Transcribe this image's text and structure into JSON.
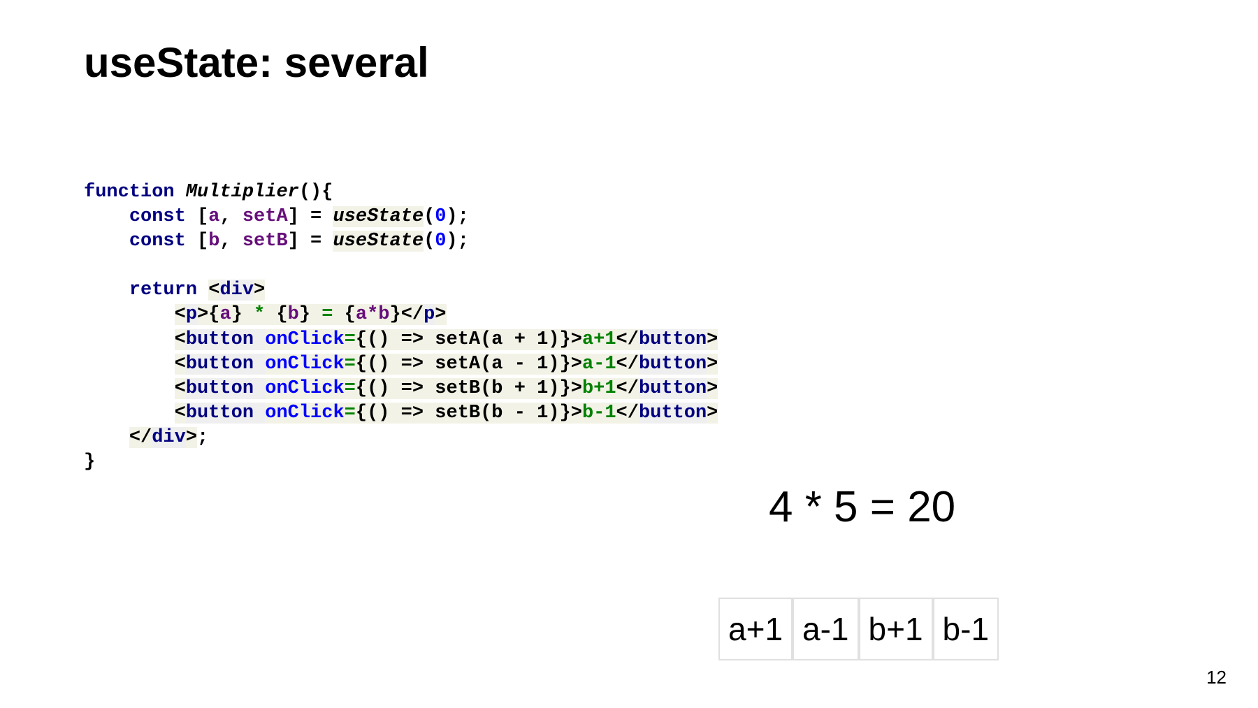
{
  "title": "useState: several",
  "code": {
    "l0_kw1": "function",
    "l0_fn": "Multiplier",
    "l0_rest": "(){",
    "l1_indent": "    ",
    "l1_kw": "const",
    "l1_b1": " [",
    "l1_a": "a",
    "l1_c1": ", ",
    "l1_setA": "setA",
    "l1_b2": "] = ",
    "l1_call": "useState",
    "l1_p1": "(",
    "l1_zero": "0",
    "l1_p2": ");",
    "l2_indent": "    ",
    "l2_kw": "const",
    "l2_b1": " [",
    "l2_b": "b",
    "l2_c1": ", ",
    "l2_setB": "setB",
    "l2_b2": "] = ",
    "l2_call": "useState",
    "l2_p1": "(",
    "l2_zero": "0",
    "l2_p2": ");",
    "l4_indent": "    ",
    "l4_kw": "return ",
    "l4_lt": "<",
    "l4_tag": "div",
    "l4_gt": ">",
    "l5_indent": "        ",
    "l5_lt1": "<",
    "l5_p": "p",
    "l5_gt1": ">",
    "l5_o1": "{",
    "l5_a": "a",
    "l5_c1": "}",
    "l5_star": " * ",
    "l5_o2": "{",
    "l5_b": "b",
    "l5_c2": "}",
    "l5_eq": " = ",
    "l5_o3": "{",
    "l5_ab": "a*b",
    "l5_c3": "}",
    "l5_lt2": "</",
    "l5_p2": "p",
    "l5_gt2": ">",
    "l6_indent": "        ",
    "l6_lt": "<",
    "l6_tag": "button ",
    "l6_attr": "onClick",
    "l6_eq": "=",
    "l6_o": "{",
    "l6_body": "() => setA(a + 1)",
    "l6_c": "}",
    "l6_gt": ">",
    "l6_txt": "a+1",
    "l6_lt2": "</",
    "l6_tag2": "button",
    "l6_gt2": ">",
    "l7_indent": "        ",
    "l7_lt": "<",
    "l7_tag": "button ",
    "l7_attr": "onClick",
    "l7_eq": "=",
    "l7_o": "{",
    "l7_body": "() => setA(a - 1)",
    "l7_c": "}",
    "l7_gt": ">",
    "l7_txt": "a-1",
    "l7_lt2": "</",
    "l7_tag2": "button",
    "l7_gt2": ">",
    "l8_indent": "        ",
    "l8_lt": "<",
    "l8_tag": "button ",
    "l8_attr": "onClick",
    "l8_eq": "=",
    "l8_o": "{",
    "l8_body": "() => setB(b + 1)",
    "l8_c": "}",
    "l8_gt": ">",
    "l8_txt": "b+1",
    "l8_lt2": "</",
    "l8_tag2": "button",
    "l8_gt2": ">",
    "l9_indent": "        ",
    "l9_lt": "<",
    "l9_tag": "button ",
    "l9_attr": "onClick",
    "l9_eq": "=",
    "l9_o": "{",
    "l9_body": "() => setB(b - 1)",
    "l9_c": "}",
    "l9_gt": ">",
    "l9_txt": "b-1",
    "l9_lt2": "</",
    "l9_tag2": "button",
    "l9_gt2": ">",
    "l10_indent": "    ",
    "l10_lt": "</",
    "l10_tag": "div",
    "l10_gt": ">",
    "l10_semi": ";",
    "l11": "}"
  },
  "output": "4 * 5 = 20",
  "buttons": {
    "b1": "a+1",
    "b2": "a-1",
    "b3": "b+1",
    "b4": "b-1"
  },
  "page_number": "12"
}
